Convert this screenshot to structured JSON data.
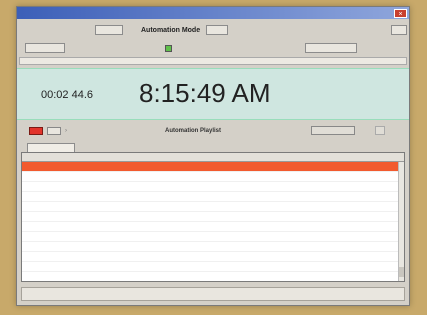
{
  "window": {
    "title": "",
    "close_glyph": "×"
  },
  "toolbar1": {
    "left_label": "",
    "button_1": "",
    "mode_label": "Automation Mode",
    "button_2": "",
    "right_label": ""
  },
  "toolbar2": {
    "button_1": "",
    "check_label": "",
    "button_2": ""
  },
  "statusline": {
    "text": ""
  },
  "clock": {
    "elapsed": "00:02 44.6",
    "time": "8:15:49 AM"
  },
  "control": {
    "caption": "Automation Playlist"
  },
  "tabs": [
    ""
  ],
  "grid": {
    "columns": [
      "",
      "",
      "",
      "",
      "",
      "",
      "",
      ""
    ],
    "rows": [
      [
        "",
        "",
        "",
        "",
        "",
        "",
        "",
        ""
      ],
      [
        "",
        "",
        "",
        "",
        "",
        "",
        "",
        ""
      ],
      [
        "",
        "",
        "",
        "",
        "",
        "",
        "",
        ""
      ],
      [
        "",
        "",
        "",
        "",
        "",
        "",
        "",
        ""
      ],
      [
        "",
        "",
        "",
        "",
        "",
        "",
        "",
        ""
      ],
      [
        "",
        "",
        "",
        "",
        "",
        "",
        "",
        ""
      ],
      [
        "",
        "",
        "",
        "",
        "",
        "",
        "",
        ""
      ],
      [
        "",
        "",
        "",
        "",
        "",
        "",
        "",
        ""
      ],
      [
        "",
        "",
        "",
        "",
        "",
        "",
        "",
        ""
      ],
      [
        "",
        "",
        "",
        "",
        "",
        "",
        "",
        ""
      ],
      [
        "",
        "",
        "",
        "",
        "",
        "",
        "",
        ""
      ],
      [
        "",
        "",
        "",
        "",
        "",
        "",
        "",
        ""
      ]
    ],
    "selected_row": 0
  },
  "colors": {
    "selected_row": "#f25a2e",
    "clock_panel": "#cfe6e0",
    "stop_button": "#e2332a",
    "title_bar": "#3c5fb8"
  }
}
